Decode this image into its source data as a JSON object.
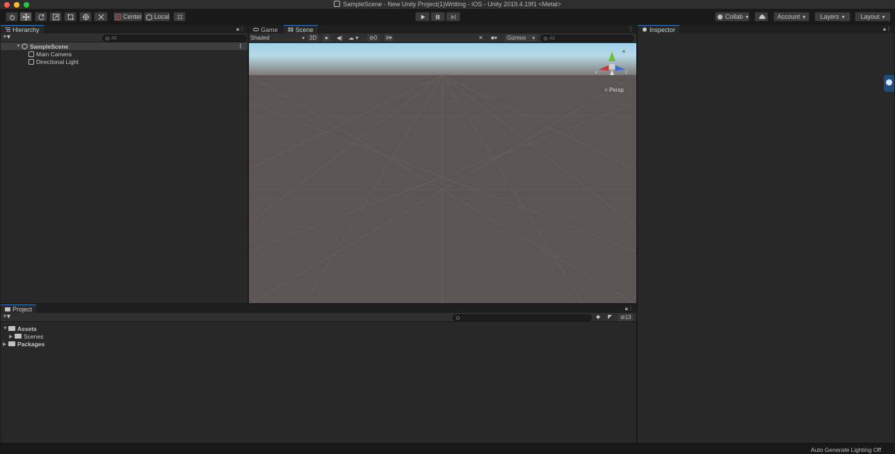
{
  "window": {
    "title": "SampleScene - New Unity Project(1)Writting - iOS - Unity 2019.4.19f1 <Metal>"
  },
  "toolbar": {
    "tools": [
      {
        "name": "hand-tool-icon"
      },
      {
        "name": "move-tool-icon"
      },
      {
        "name": "rotate-tool-icon"
      },
      {
        "name": "scale-tool-icon"
      },
      {
        "name": "rect-tool-icon"
      },
      {
        "name": "transform-tool-icon"
      },
      {
        "name": "custom-tool-icon"
      }
    ],
    "pivot_label": "Center",
    "space_label": "Local",
    "collab_label": "Collab",
    "account_label": "Account",
    "layers_label": "Layers",
    "layout_label": "Layout"
  },
  "hierarchy": {
    "tab_label": "Hierarchy",
    "search_placeholder": "All",
    "scene_name": "SampleScene",
    "items": [
      "Main Camera",
      "Directional Light"
    ]
  },
  "scene_panel": {
    "tabs": [
      "Game",
      "Scene"
    ],
    "shading_mode": "Shaded",
    "mode_2d": "2D",
    "hidden_count": "0",
    "gizmos_label": "Gizmos",
    "search_placeholder": "All",
    "projection_label": "Persp",
    "axis_labels": {
      "x": "x",
      "z": "z"
    }
  },
  "inspector": {
    "tab_label": "Inspector"
  },
  "project": {
    "tab_label": "Project",
    "hidden_count": "13",
    "assets_label": "Assets",
    "scenes_label": "Scenes",
    "packages_label": "Packages"
  },
  "status": {
    "text": "Auto Generate Lighting Off"
  },
  "colors": {
    "accent": "#3a79bb",
    "sky": "#9fd3ec",
    "ground": "#5d5553",
    "gizmo_x": "#c33b3b",
    "gizmo_y": "#6bc13a",
    "gizmo_z": "#3a6bd6"
  }
}
